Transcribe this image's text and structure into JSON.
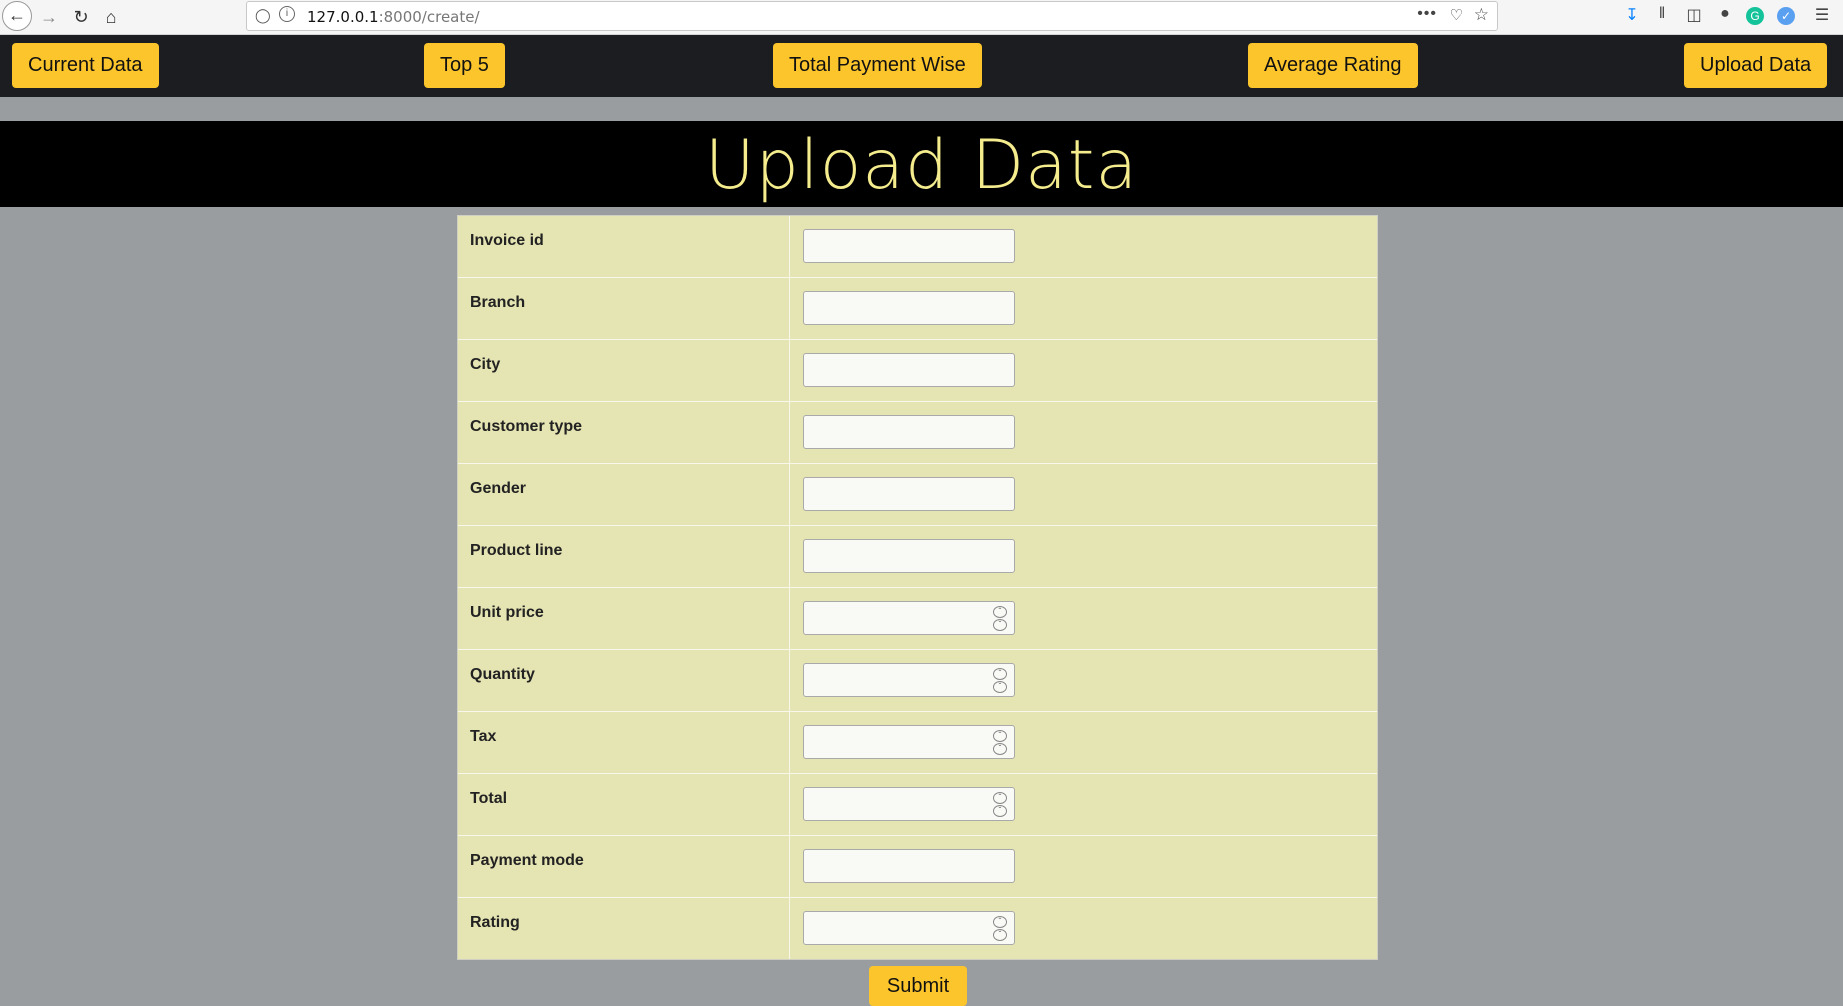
{
  "browser": {
    "url_host": "127.0.0.1",
    "url_path": ":8000/create/",
    "more_icon": "•••",
    "icons": [
      "back-arrow-icon",
      "forward-arrow-icon",
      "reload-icon",
      "home-icon",
      "shield-icon",
      "info-icon",
      "pocket-icon",
      "star-icon",
      "download-icon",
      "library-icon",
      "sidebar-icon",
      "account-icon",
      "grammarly-icon",
      "extension-icon",
      "menu-icon"
    ]
  },
  "nav": {
    "current_data": "Current Data",
    "top5": "Top 5",
    "total_payment_wise": "Total Payment Wise",
    "average_rating": "Average Rating",
    "upload_data": "Upload Data"
  },
  "page": {
    "title": "Upload Data",
    "submit_label": "Submit"
  },
  "form": {
    "fields": [
      {
        "label": "Invoice id",
        "type": "text"
      },
      {
        "label": "Branch",
        "type": "text"
      },
      {
        "label": "City",
        "type": "text"
      },
      {
        "label": "Customer type",
        "type": "text"
      },
      {
        "label": "Gender",
        "type": "text"
      },
      {
        "label": "Product line",
        "type": "text"
      },
      {
        "label": "Unit price",
        "type": "number"
      },
      {
        "label": "Quantity",
        "type": "number"
      },
      {
        "label": "Tax",
        "type": "number"
      },
      {
        "label": "Total",
        "type": "number"
      },
      {
        "label": "Payment mode",
        "type": "text"
      },
      {
        "label": "Rating",
        "type": "number"
      }
    ]
  },
  "colors": {
    "accent": "#fdc52c",
    "navbar": "#1c1d21",
    "background": "#9a9d9f",
    "title_text": "#f4ec8d",
    "form_bg": "#e5e4b3"
  }
}
